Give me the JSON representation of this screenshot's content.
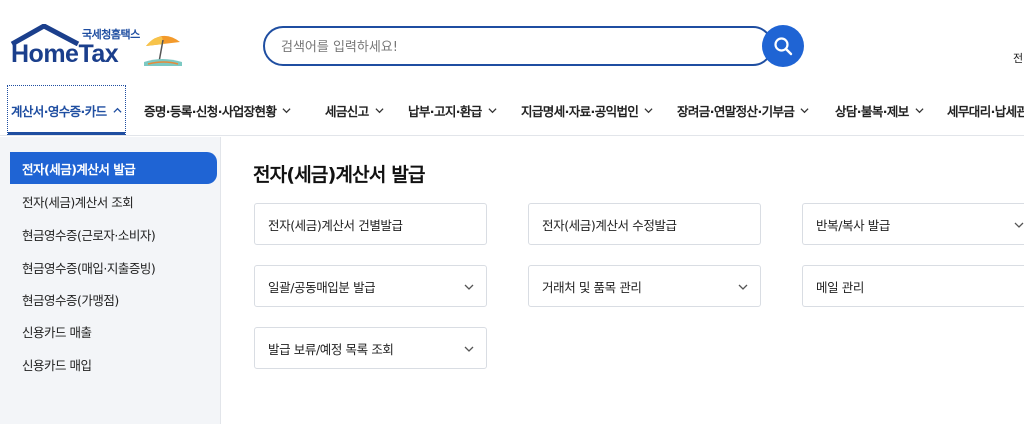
{
  "header": {
    "logo_sub": "국세청홈택스",
    "logo_main": "HomeTax",
    "search_placeholder": "검색어를 입력하세요!",
    "corner_text": "전"
  },
  "gnb": {
    "items": [
      {
        "label": "계산서·영수증·카드"
      },
      {
        "label": "증명·등록·신청·사업장현황"
      },
      {
        "label": "세금신고"
      },
      {
        "label": "납부·고지·환급"
      },
      {
        "label": "지급명세·자료·공익법인"
      },
      {
        "label": "장려금·연말정산·기부금"
      },
      {
        "label": "상담·불복·제보"
      },
      {
        "label": "세무대리·납세관"
      }
    ]
  },
  "side": {
    "items": [
      {
        "label": "전자(세금)계산서 발급"
      },
      {
        "label": "전자(세금)계산서 조회"
      },
      {
        "label": "현금영수증(근로자·소비자)"
      },
      {
        "label": "현금영수증(매입·지출증빙)"
      },
      {
        "label": "현금영수증(가맹점)"
      },
      {
        "label": "신용카드 매출"
      },
      {
        "label": "신용카드 매입"
      }
    ]
  },
  "main": {
    "title": "전자(세금)계산서 발급",
    "cards": [
      {
        "label": "전자(세금)계산서 건별발급"
      },
      {
        "label": "전자(세금)계산서 수정발급"
      },
      {
        "label": "반복/복사 발급"
      },
      {
        "label": "일괄/공동매입분 발급"
      },
      {
        "label": "거래처 및 품목 관리"
      },
      {
        "label": "메일 관리"
      },
      {
        "label": "발급 보류/예정 목록 조회"
      }
    ]
  },
  "colors": {
    "brand": "#1f4ea1",
    "accent": "#1f64d4",
    "side_bg": "#f3f5f8"
  },
  "icons": {
    "search": "search-icon",
    "chevron": "chevron-down-icon",
    "active_chevron": "chevron-up-icon"
  }
}
